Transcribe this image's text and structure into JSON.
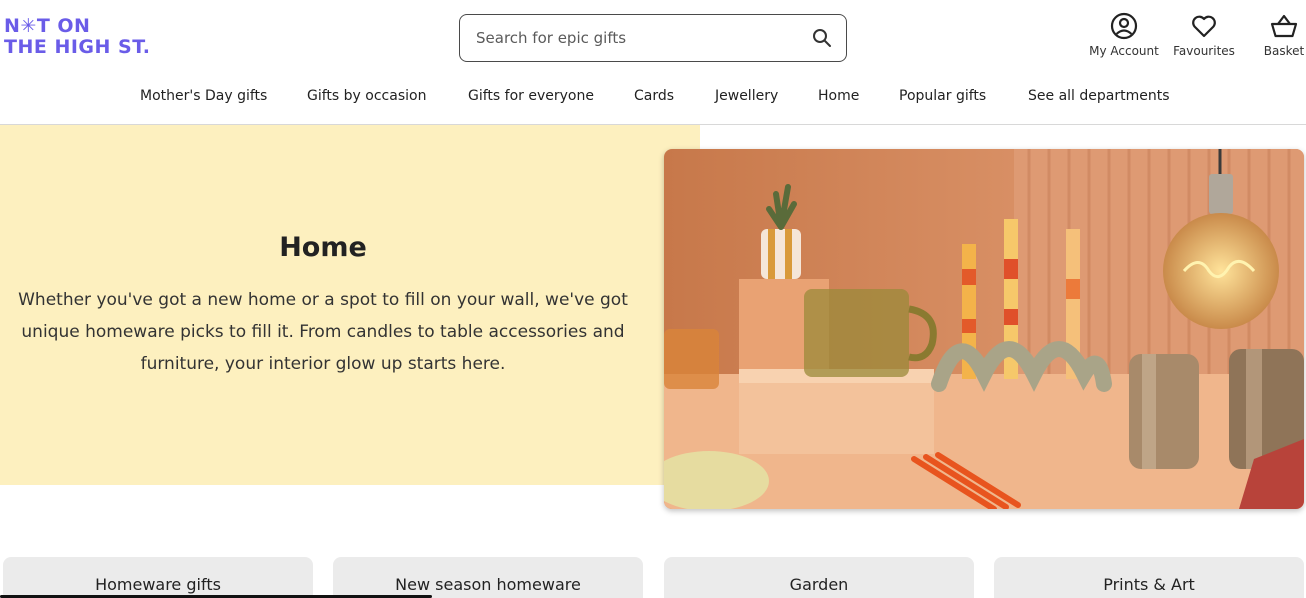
{
  "brand": {
    "logo_line1": "N✳T ON",
    "logo_line2": "THE HIGH ST.",
    "color": "#6a5ce8"
  },
  "search": {
    "placeholder": "Search for epic gifts",
    "icon": "search-icon"
  },
  "utility": {
    "account_label": "My Account",
    "favourites_label": "Favourites",
    "basket_label": "Basket"
  },
  "nav": {
    "items": [
      "Mother's Day gifts",
      "Gifts by occasion",
      "Gifts for everyone",
      "Cards",
      "Jewellery",
      "Home",
      "Popular gifts",
      "See all departments"
    ]
  },
  "hero": {
    "title": "Home",
    "description_line1": "Whether you've got a new home or a spot to fill on your wall, we've got",
    "description_line2": "unique homeware picks to fill it. From candles to table accessories and",
    "description_line3": "furniture, your interior glow up starts here.",
    "background_color": "#fdf0bf"
  },
  "categories": [
    "Homeware gifts",
    "New season homeware",
    "Garden",
    "Prints & Art"
  ]
}
